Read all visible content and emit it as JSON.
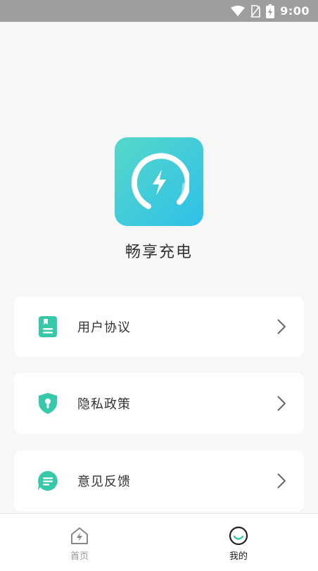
{
  "status_bar": {
    "time": "9:00"
  },
  "app": {
    "name": "畅享充电"
  },
  "menu": [
    {
      "label": "用户协议",
      "icon": "document-icon"
    },
    {
      "label": "隐私政策",
      "icon": "shield-icon"
    },
    {
      "label": "意见反馈",
      "icon": "feedback-icon"
    }
  ],
  "nav": {
    "home_label": "首页",
    "mine_label": "我的"
  },
  "colors": {
    "accent": "#2fc9b0",
    "logo_gradient": [
      "#56d8c9",
      "#2ec0e8"
    ]
  }
}
